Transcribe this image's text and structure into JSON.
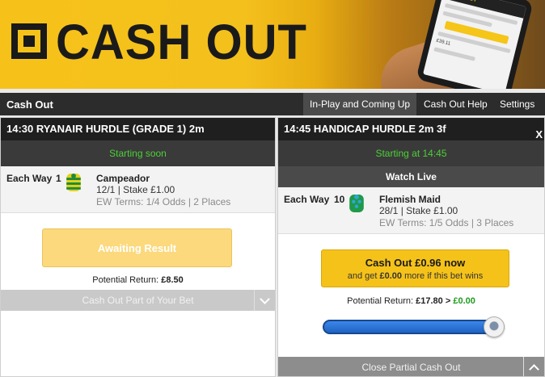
{
  "banner": {
    "title": "CASH OUT",
    "phone_header": "CASH OUT",
    "phone_amount": "£39.11"
  },
  "topnav": {
    "title": "Cash Out",
    "tabs": [
      {
        "label": "In-Play and Coming Up",
        "active": true
      },
      {
        "label": "Cash Out Help",
        "active": false
      },
      {
        "label": "Settings",
        "active": false
      }
    ]
  },
  "cards": [
    {
      "header": "14:30 RYANAIR HURDLE (GRADE 1) 2m",
      "status": "Starting soon",
      "bet": {
        "type": "Each Way",
        "number": "1",
        "horse": "Campeador",
        "odds_stake": "12/1 | Stake £1.00",
        "terms": "EW Terms: 1/4 Odds | 2 Places"
      },
      "button_label": "Awaiting Result",
      "potential_label": "Potential Return: ",
      "potential_value": "£8.50",
      "partial_label": "Cash Out Part of Your Bet"
    },
    {
      "header": "14:45 HANDICAP HURDLE 2m 3f",
      "close": "X",
      "status": "Starting at 14:45",
      "watch_live": "Watch Live",
      "bet": {
        "type": "Each Way",
        "number": "10",
        "horse": "Flemish Maid",
        "odds_stake": "28/1 | Stake £1.00",
        "terms": "EW Terms: 1/5 Odds | 3 Places"
      },
      "cashout_main": "Cash Out £0.96 now",
      "cashout_sub_prefix": "and get ",
      "cashout_sub_amount": "£0.00",
      "cashout_sub_suffix": " more if this bet wins",
      "potential_label": "Potential Return: ",
      "potential_from": "£17.80",
      "potential_arrow": " > ",
      "potential_to": "£0.00",
      "slider_fraction": 0.95,
      "partial_label": "Close Partial Cash Out"
    }
  ],
  "colors": {
    "brand_yellow": "#f5c21a",
    "status_green": "#4cd137",
    "slider_blue": "#1f63c4"
  },
  "icons": [
    "silk-icon",
    "chevron-down-icon",
    "chevron-up-icon",
    "close-icon"
  ]
}
